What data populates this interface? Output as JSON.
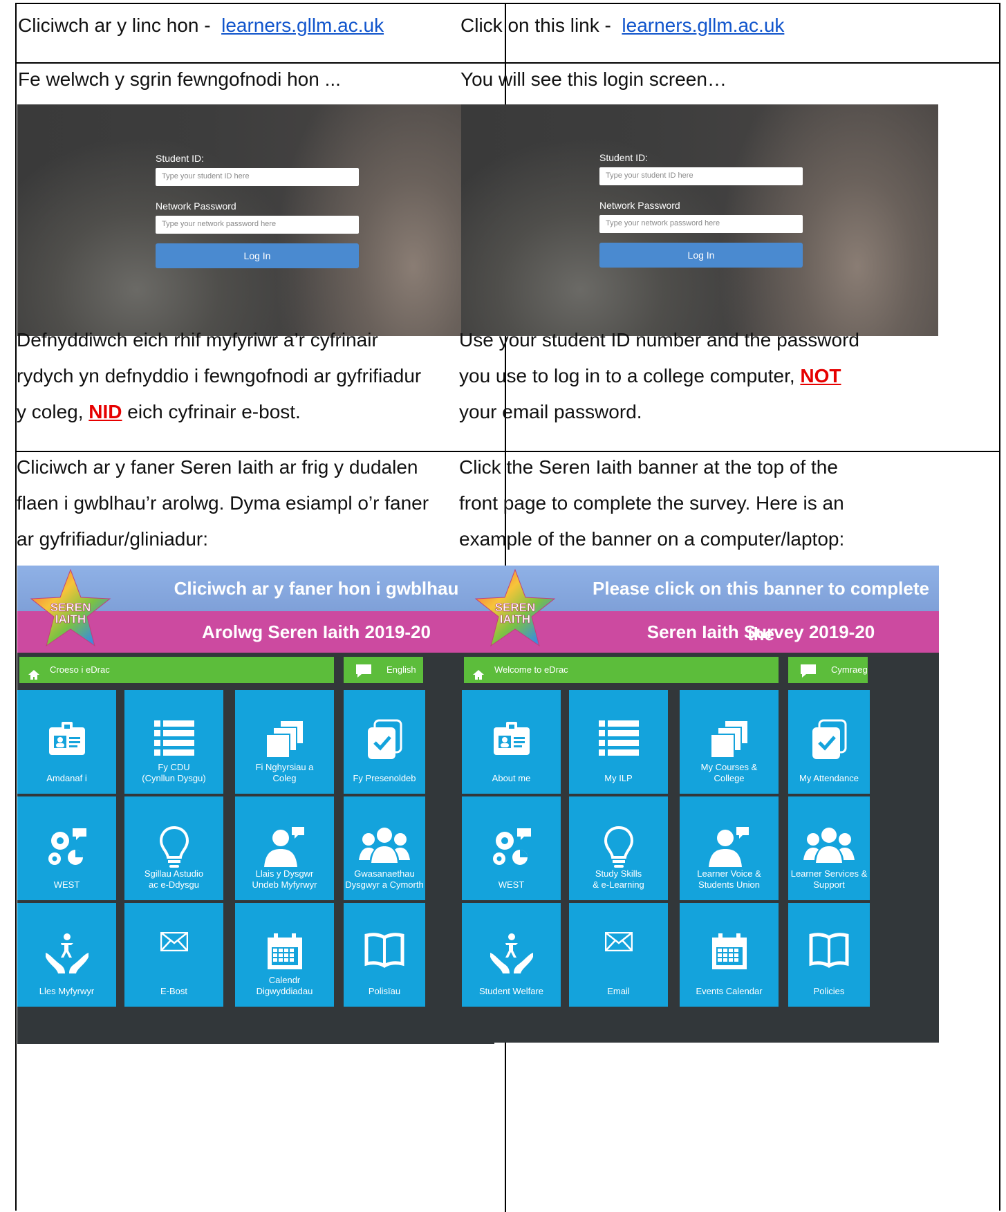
{
  "rows": {
    "link": {
      "cy": {
        "prefix": "Cliciwch ar y linc hon - ",
        "url": "learners.gllm.ac.uk"
      },
      "en": {
        "prefix": "Click on this link - ",
        "url": "learners.gllm.ac.uk"
      }
    },
    "login": {
      "cy": {
        "intro": "Fe welwch y sgrin fewngofnodi hon ...",
        "instr_1": "Defnyddiwch eich rhif myfyriwr a’r cyfrinair",
        "instr_2": "rydych yn defnyddio i fewngofnodi ar gyfrifiadur",
        "instr_3a": "y coleg, ",
        "instr_warn": "NID",
        "instr_3b": " eich cyfrinair e-bost."
      },
      "en": {
        "intro": "You will see this login screen…",
        "instr_1": "Use your student ID number and the password",
        "instr_2a": "you use to log in to a college computer, ",
        "instr_warn": "NOT",
        "instr_3": "your email password."
      }
    },
    "banner": {
      "cy": {
        "line1": "Cliciwch ar y faner Seren Iaith ar frig y dudalen",
        "line2": "flaen i gwblhau’r arolwg. Dyma esiampl o’r faner",
        "line3": "ar gyfrifiadur/gliniadur:"
      },
      "en": {
        "line1": "Click the Seren Iaith banner at the top of the",
        "line2": "front page to complete the survey. Here is an",
        "line3": "example of the banner on a computer/laptop:"
      }
    }
  },
  "login_screen": {
    "student_id_label": "Student ID:",
    "student_id_placeholder": "Type your student ID here",
    "password_label": "Network Password",
    "password_placeholder": "Type your network password here",
    "login_button": "Log In"
  },
  "edrac": {
    "cy": {
      "star_text_1": "SEREN",
      "star_text_2": "IAITH",
      "banner_1": "Cliciwch ar y faner hon i gwblhau",
      "banner_2": "Arolwg Seren Iaith 2019-20",
      "home": "Croeso i eDrac",
      "lang": "English",
      "tiles": [
        {
          "l1": "Amdanaf i",
          "l2": "",
          "icon": "id-card-icon"
        },
        {
          "l1": "Fy CDU",
          "l2": "(Cynllun Dysgu)",
          "icon": "list-icon"
        },
        {
          "l1": "Fi Nghyrsiau a",
          "l2": "Coleg",
          "icon": "stack-icon"
        },
        {
          "l1": "Fy Presenoldeb",
          "l2": "",
          "icon": "check-card-icon"
        },
        {
          "l1": "WEST",
          "l2": "",
          "icon": "gears-icon"
        },
        {
          "l1": "Sgillau Astudio",
          "l2": "ac e-Ddysgu",
          "icon": "bulb-icon"
        },
        {
          "l1": "Llais y Dysgwr",
          "l2": "Undeb Myfyrwyr",
          "icon": "person-speech-icon"
        },
        {
          "l1": "Gwasanaethau",
          "l2": "Dysgwyr a Cymorth",
          "icon": "group-icon"
        },
        {
          "l1": "Lles Myfyrwyr",
          "l2": "",
          "icon": "welfare-icon"
        },
        {
          "l1": "E-Bost",
          "l2": "",
          "icon": "envelope-icon"
        },
        {
          "l1": "Calendr",
          "l2": "Digwyddiadau",
          "icon": "calendar-icon"
        },
        {
          "l1": "Polisïau",
          "l2": "",
          "icon": "book-icon"
        }
      ]
    },
    "en": {
      "star_text_1": "SEREN",
      "star_text_2": "IAITH",
      "banner_1": "Please click on this banner to complete the",
      "banner_2": "Seren Iaith Survey 2019-20",
      "home": "Welcome to eDrac",
      "lang": "Cymraeg",
      "tiles": [
        {
          "l1": "About me",
          "l2": "",
          "icon": "id-card-icon"
        },
        {
          "l1": "My ILP",
          "l2": "",
          "icon": "list-icon"
        },
        {
          "l1": "My Courses &",
          "l2": "College",
          "icon": "stack-icon"
        },
        {
          "l1": "My Attendance",
          "l2": "",
          "icon": "check-card-icon"
        },
        {
          "l1": "WEST",
          "l2": "",
          "icon": "gears-icon"
        },
        {
          "l1": "Study Skills",
          "l2": "& e-Learning",
          "icon": "bulb-icon"
        },
        {
          "l1": "Learner Voice &",
          "l2": "Students Union",
          "icon": "person-speech-icon"
        },
        {
          "l1": "Learner Services &",
          "l2": "Support",
          "icon": "group-icon"
        },
        {
          "l1": "Student Welfare",
          "l2": "",
          "icon": "welfare-icon"
        },
        {
          "l1": "Email",
          "l2": "",
          "icon": "envelope-icon"
        },
        {
          "l1": "Events Calendar",
          "l2": "",
          "icon": "calendar-icon"
        },
        {
          "l1": "Policies",
          "l2": "",
          "icon": "book-icon"
        }
      ]
    }
  },
  "colors": {
    "link": "#1155cc",
    "warning": "#e60000",
    "tile": "#14a3dc",
    "green_bar": "#5cbd3b",
    "banner_pink": "#cc4aa0",
    "banner_blue": "#8fb1e6"
  }
}
